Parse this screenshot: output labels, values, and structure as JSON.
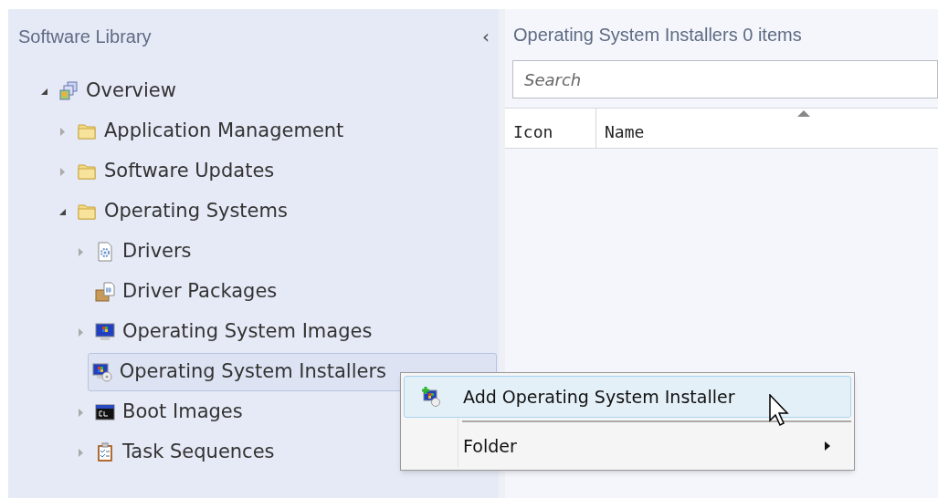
{
  "sidebar": {
    "title": "Software Library",
    "collapse_glyph": "‹",
    "tree": [
      {
        "label": "Overview",
        "kind": "overview",
        "expanded": true,
        "selected": false,
        "children": [
          {
            "label": "Application Management",
            "kind": "folder",
            "expanded": false,
            "selected": false
          },
          {
            "label": "Software Updates",
            "kind": "folder",
            "expanded": false,
            "selected": false
          },
          {
            "label": "Operating Systems",
            "kind": "folder",
            "expanded": true,
            "selected": false,
            "children": [
              {
                "label": "Drivers",
                "kind": "drivers",
                "expanded": false,
                "selected": false
              },
              {
                "label": "Driver Packages",
                "kind": "driver-package",
                "selected": false
              },
              {
                "label": "Operating System Images",
                "kind": "os-image",
                "expanded": false,
                "selected": false
              },
              {
                "label": "Operating System Installers",
                "kind": "os-installer",
                "selected": true
              },
              {
                "label": "Boot Images",
                "kind": "boot-image",
                "expanded": false,
                "selected": false
              },
              {
                "label": "Task Sequences",
                "kind": "task-sequence",
                "expanded": false,
                "selected": false
              }
            ]
          }
        ]
      }
    ]
  },
  "content": {
    "title": "Operating System Installers 0 items",
    "search": {
      "placeholder": "Search"
    },
    "table": {
      "columns": [
        {
          "label": "Icon",
          "sorted": false
        },
        {
          "label": "Name",
          "sorted": true
        }
      ]
    }
  },
  "context_menu": {
    "items": [
      {
        "kind": "action",
        "label": "Add Operating System Installer",
        "selected": true
      },
      {
        "kind": "separator"
      },
      {
        "kind": "submenu",
        "label": "Folder",
        "selected": false
      }
    ]
  }
}
